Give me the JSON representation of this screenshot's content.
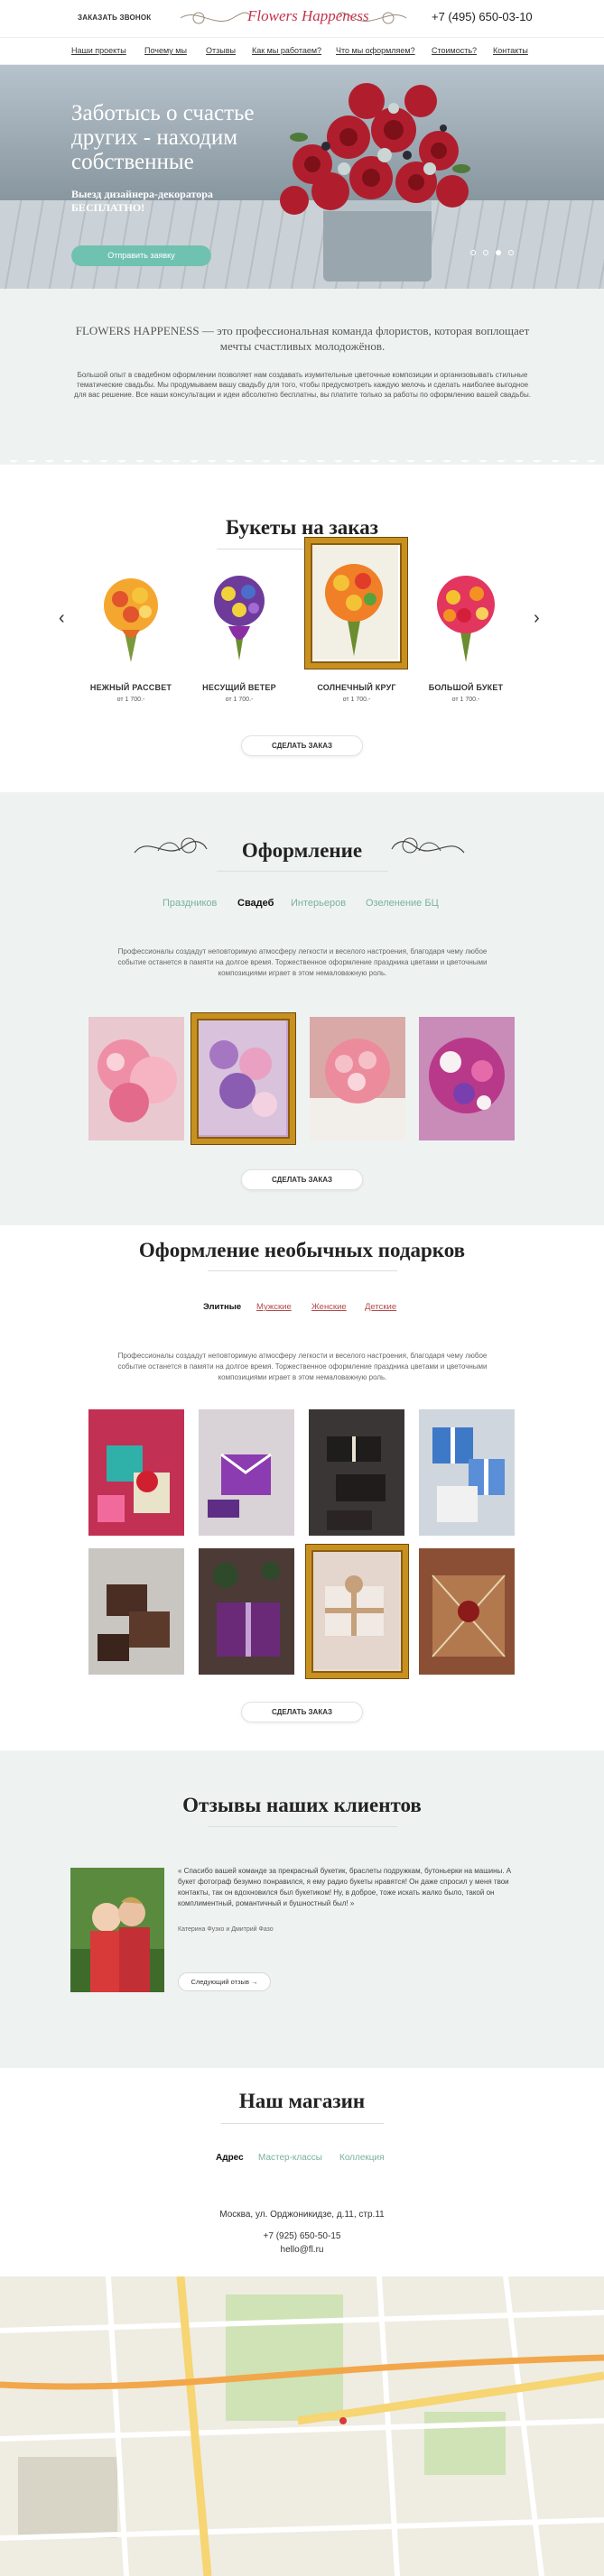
{
  "header": {
    "call_label": "ЗАКАЗАТЬ ЗВОНОК",
    "logo_text": "Flowers Happeness",
    "phone": "+7 (495) 650-03-10"
  },
  "nav": [
    "Наши проекты",
    "Почему мы",
    "Отзывы",
    "Как мы работаем?",
    "Что мы оформляем?",
    "Стоимость?",
    "Контакты"
  ],
  "hero": {
    "title": "Заботысь о счастье других - находим собственные",
    "subtitle": "Выезд дизайнера-декоратора БЕСПЛАТНО!",
    "button": "Отправить заявку"
  },
  "intro": {
    "title": "FLOWERS HAPPENESS — это профессиональная команда флористов, которая воплощает мечты счастливых молодожёнов.",
    "text": "Большой опыт в свадебном оформлении позволяет нам создавать изумительные цветочные композиции и организовывать стильные тематические свадьбы. Мы продумываем вашу свадьбу для того, чтобы предусмотреть каждую мелочь и сделать наиболее выгодное для вас решение. Все наши консультации и идеи абсолютно бесплатны, вы платите только за работы по оформлению вашей свадьбы."
  },
  "bouquets": {
    "title": "Букеты на заказ",
    "items": [
      {
        "name": "НЕЖНЫЙ РАССВЕТ",
        "price": "от 1 700.-"
      },
      {
        "name": "НЕСУЩИЙ ВЕТЕР",
        "price": "от 1 700.-"
      },
      {
        "name": "СОЛНЕЧНЫЙ КРУГ",
        "price": "от 1 700.-"
      },
      {
        "name": "БОЛЬШОЙ БУКЕТ",
        "price": "от 1 700.-"
      }
    ],
    "button": "СДЕЛАТЬ ЗАКАЗ"
  },
  "decor": {
    "title": "Оформление",
    "tabs": [
      "Праздников",
      "Свадеб",
      "Интерьеров",
      "Озеленение БЦ"
    ],
    "active_tab": "Свадеб",
    "text": "Профессионалы создадут неповторимую атмосферу легкости и веселого настроения, благодаря чему любое событие останется в памяти на долгое время. Торжественное оформление праздника цветами и цветочными композициями играет в этом немаловажную роль.",
    "button": "СДЕЛАТЬ ЗАКАЗ"
  },
  "gifts": {
    "title": "Оформление необычных подарков",
    "tabs": [
      "Элитные",
      "Мужские",
      "Женские",
      "Детские"
    ],
    "active_tab": "Элитные",
    "text": "Профессионалы создадут неповторимую атмосферу легкости и веселого настроения, благодаря чему любое событие останется в памяти на долгое время. Торжественное оформление праздника цветами и цветочными композициями играет в этом немаловажную роль.",
    "button": "СДЕЛАТЬ ЗАКАЗ"
  },
  "reviews": {
    "title": "Отзывы наших клиентов",
    "text": "« Спасибо вашей команде за прекрасный букетик, браслеты подружкам, бутоньерки на машины. А букет фотограф безумно понравился, я ему радио букеты нравятся! Он даже спросил у меня твои контакты, так он вдохновился был букетиком! Ну, в доброе, тоже искать жалко было, такой он комплиментный, романтичный и бушностный был! »",
    "author": "Катерина Фузко и Дмитрий Фазо",
    "button": "Следующий отзыв  →"
  },
  "shop": {
    "title": "Наш магазин",
    "tabs": [
      "Адрес",
      "Мастер-классы",
      "Коллекция"
    ],
    "active_tab": "Адрес",
    "address": "Москва, ул. Орджоникидзе, д.11, стр.11",
    "phone": "+7 (925) 650-50-15",
    "email": "hello@fl.ru"
  },
  "colors": {
    "accent": "#6fc2b0",
    "brand": "#c2334b",
    "section_bg": "#eef3f2",
    "gift_tab": "#b34b4b"
  }
}
